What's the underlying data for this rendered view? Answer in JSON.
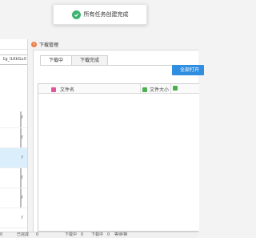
{
  "toast": {
    "icon": "check-icon",
    "message": "所有任务创建完成",
    "color": "#3cb371"
  },
  "left": {
    "field_value": "1g_ILKkGuX",
    "items": [
      "r",
      "r",
      "r",
      "r",
      "r",
      "r"
    ]
  },
  "download_manager": {
    "title": "下载管理",
    "tabs": [
      "下载中",
      "下载完成"
    ],
    "open_button": "全部打开",
    "columns": {
      "name": "文件名",
      "size": "文件大小"
    },
    "accent": "#2f8ee0"
  },
  "statusbar": {
    "completed_label": "已完成",
    "completed_value": "0",
    "downloading_label": "下载中",
    "downloading_value": "0",
    "downloading_label2": "下载中",
    "downloading_value2": "0",
    "waiting_label": "等待中",
    "waiting_value": "0",
    "leading_value": "0"
  }
}
